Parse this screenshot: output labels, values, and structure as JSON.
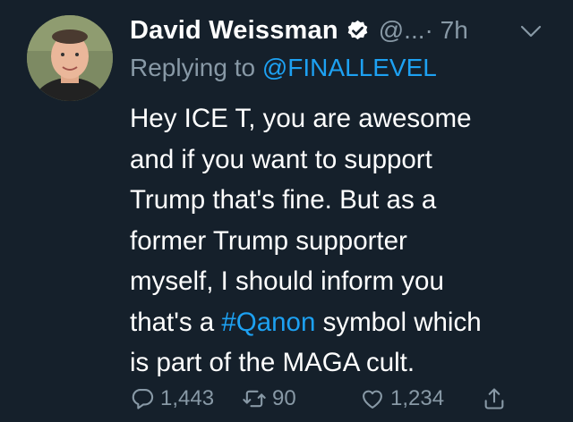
{
  "tweet": {
    "author_name": "David Weissman",
    "handle": "@...",
    "time": " · 7h",
    "replying_prefix": "Replying to ",
    "replying_to": "@FINALLEVEL",
    "body": {
      "line1": "Hey ICE T, you are awesome",
      "line2": "and if you want to support",
      "line3": "Trump that's fine. But as a",
      "line4": "former Trump supporter",
      "line5": "myself, I should inform you",
      "line6_pre": "that's a ",
      "hashtag": "#Qanon",
      "line6_post": " symbol which",
      "line7": "is part of the MAGA cult."
    },
    "actions": {
      "replies": "1,443",
      "retweets": "90",
      "likes": "1,234"
    }
  },
  "colors": {
    "background": "#15202b",
    "text": "#ffffff",
    "muted": "#8899a6",
    "link": "#1da1f2"
  },
  "icons": [
    "verified-badge-icon",
    "chevron-down-icon",
    "reply-icon",
    "retweet-icon",
    "like-icon",
    "share-icon"
  ]
}
